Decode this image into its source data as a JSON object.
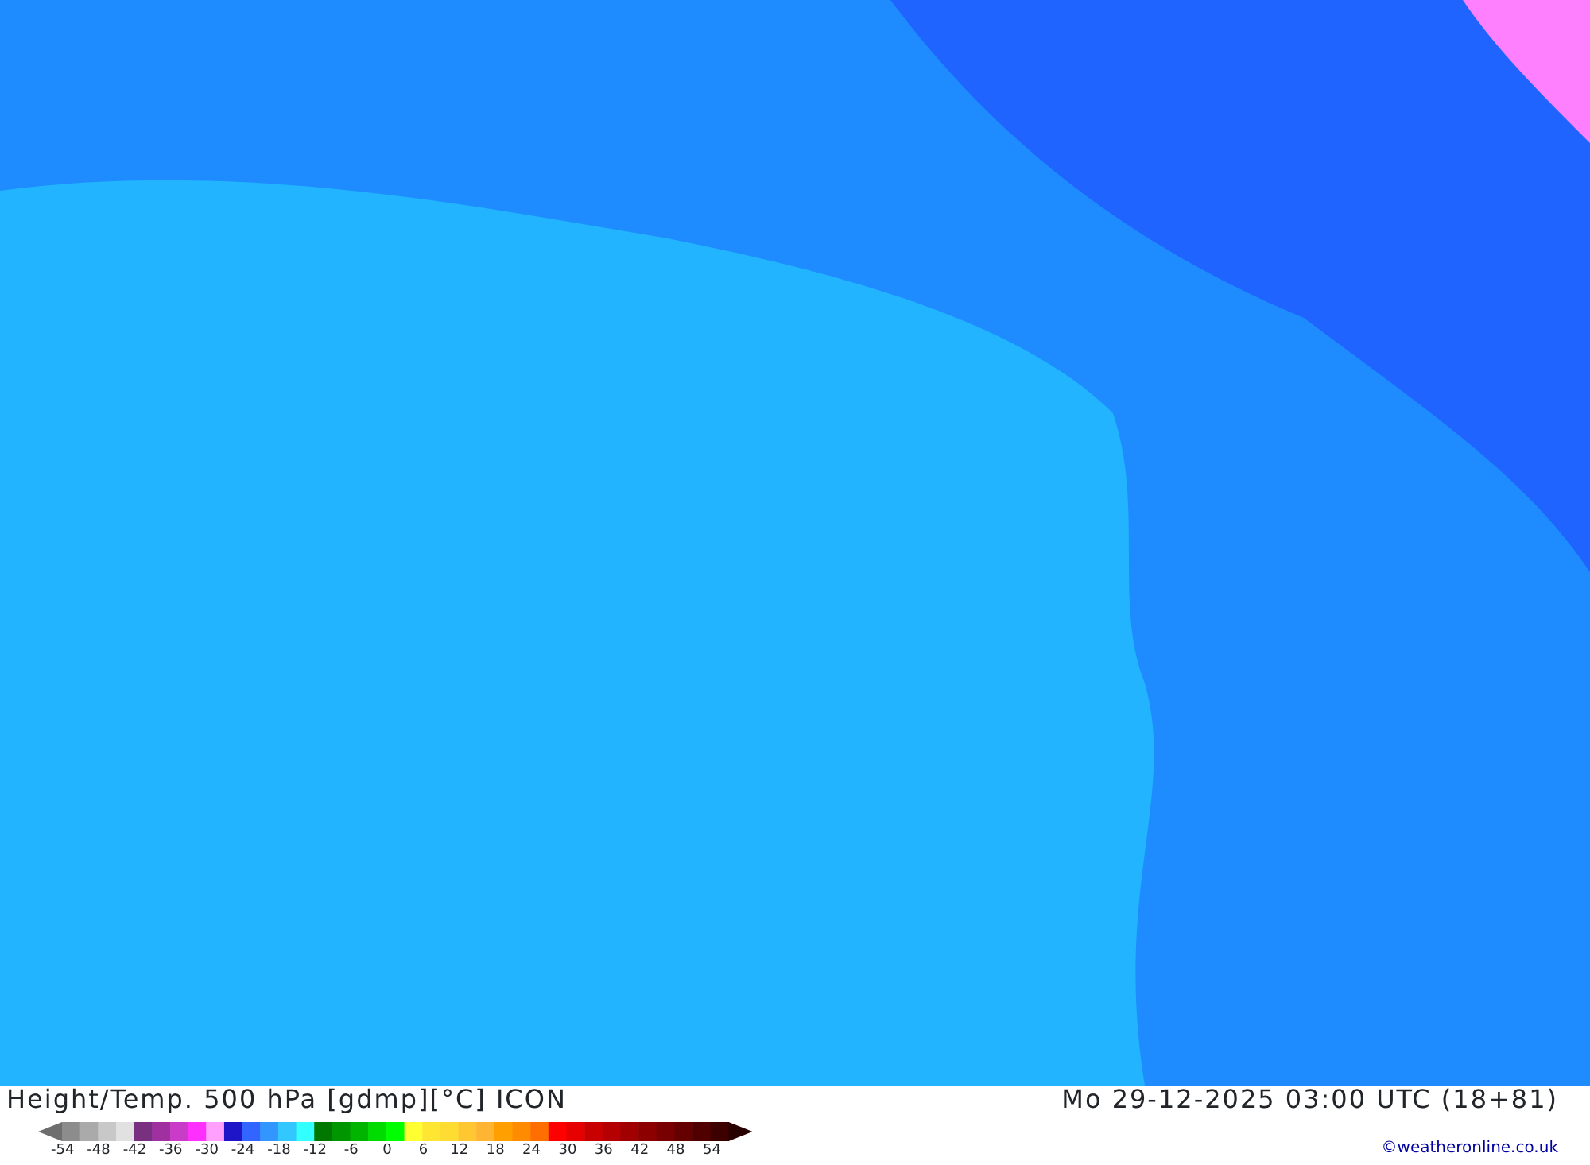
{
  "title": "Height/Temp. 500 hPa [gdmp][°C] ICON",
  "valid_time": "Mo 29-12-2025 03:00 UTC (18+81)",
  "credit": "©weatheronline.co.uk",
  "legend": {
    "swatches": [
      {
        "color": "#8c8c8c"
      },
      {
        "color": "#aaaaaa"
      },
      {
        "color": "#c8c8c8"
      },
      {
        "color": "#e1e1e1"
      },
      {
        "color": "#7a3080"
      },
      {
        "color": "#a030a0"
      },
      {
        "color": "#c83cc8"
      },
      {
        "color": "#ff30ff"
      },
      {
        "color": "#ffa0ff"
      },
      {
        "color": "#1e14c8"
      },
      {
        "color": "#3264ff"
      },
      {
        "color": "#3296ff"
      },
      {
        "color": "#32c8ff"
      },
      {
        "color": "#32ffff"
      },
      {
        "color": "#007800"
      },
      {
        "color": "#009600"
      },
      {
        "color": "#00b400"
      },
      {
        "color": "#00dc00"
      },
      {
        "color": "#00ff00"
      },
      {
        "color": "#ffff32"
      },
      {
        "color": "#ffe632"
      },
      {
        "color": "#ffdc32"
      },
      {
        "color": "#ffc832"
      },
      {
        "color": "#ffb432"
      },
      {
        "color": "#ffa000"
      },
      {
        "color": "#ff8c00"
      },
      {
        "color": "#ff6e00"
      },
      {
        "color": "#ff0000"
      },
      {
        "color": "#e60000"
      },
      {
        "color": "#c80000"
      },
      {
        "color": "#b40000"
      },
      {
        "color": "#a00000"
      },
      {
        "color": "#8c0000"
      },
      {
        "color": "#780000"
      },
      {
        "color": "#640000"
      },
      {
        "color": "#500000"
      },
      {
        "color": "#3c0000"
      }
    ],
    "ticks": [
      "-54",
      "-48",
      "-42",
      "-36",
      "-30",
      "-24",
      "-18",
      "-12",
      "-6",
      "0",
      "6",
      "12",
      "18",
      "24",
      "30",
      "36",
      "42",
      "48",
      "54"
    ]
  }
}
